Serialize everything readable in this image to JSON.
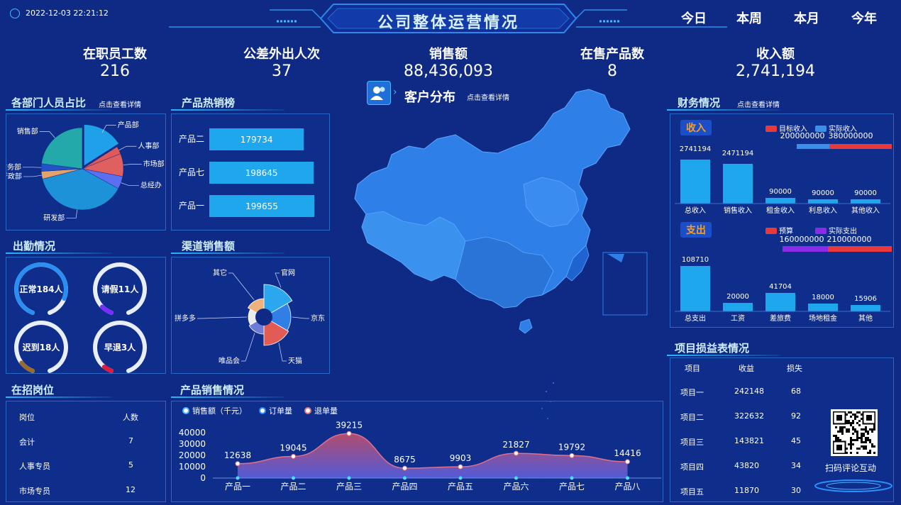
{
  "header": {
    "datetime": "2022-12-03 22:21:12",
    "title": "公司整体运营情况",
    "periods": [
      "今日",
      "本周",
      "本月",
      "今年"
    ]
  },
  "kpis": [
    {
      "label": "在职员工数",
      "value": "216"
    },
    {
      "label": "公差外出人次",
      "value": "37"
    },
    {
      "label": "销售额",
      "value": "88,436,093"
    },
    {
      "label": "在售产品数",
      "value": "8"
    },
    {
      "label": "收入额",
      "value": "2,741,194"
    }
  ],
  "dept": {
    "title": "各部门人员占比",
    "link": "点击查看详情",
    "slices": [
      {
        "name": "产品部",
        "value": 16,
        "color": "#1fa0e8"
      },
      {
        "name": "人事部",
        "value": 3,
        "color": "#e05a5a"
      },
      {
        "name": "市场部",
        "value": 9,
        "color": "#e06060"
      },
      {
        "name": "总经办",
        "value": 5,
        "color": "#5b6ff0"
      },
      {
        "name": "研发部",
        "value": 38,
        "color": "#1d92d8"
      },
      {
        "name": "行政部",
        "value": 3,
        "color": "#e4a36b"
      },
      {
        "name": "财务部",
        "value": 3,
        "color": "#2453c8"
      },
      {
        "name": "销售部",
        "value": 23,
        "color": "#23a9a9"
      }
    ]
  },
  "hot": {
    "title": "产品热销榜",
    "items": [
      {
        "name": "产品二",
        "value": 179734
      },
      {
        "name": "产品七",
        "value": 198645
      },
      {
        "name": "产品一",
        "value": 199655
      }
    ]
  },
  "map": {
    "title": "客户分布",
    "link": "点击查看详情"
  },
  "finance": {
    "title": "财务情况",
    "link": "点击查看详情",
    "income": {
      "label": "收入",
      "legend": [
        "目标收入",
        "实际收入"
      ],
      "target_total": "200000000",
      "actual_total": "380000000",
      "categories": [
        "总收入",
        "销售收入",
        "租金收入",
        "利息收入",
        "其他收入"
      ],
      "values": [
        2741194,
        2471194,
        90000,
        90000,
        90000
      ]
    },
    "expense": {
      "label": "支出",
      "legend": [
        "预算",
        "实际支出"
      ],
      "budget_total": "160000000",
      "actual_total": "210000000",
      "categories": [
        "总支出",
        "工资",
        "差旅费",
        "场地租金",
        "其他"
      ],
      "values": [
        108710,
        20000,
        41704,
        18000,
        15906
      ]
    }
  },
  "attendance": {
    "title": "出勤情况",
    "items": [
      {
        "label": "正常184人",
        "pct": 0.85,
        "color": "#2b8ff2"
      },
      {
        "label": "请假11人",
        "pct": 0.08,
        "color": "#7a2bff"
      },
      {
        "label": "迟到18人",
        "pct": 0.1,
        "color": "#9a6b2a"
      },
      {
        "label": "早退3人",
        "pct": 0.06,
        "color": "#e01a3c"
      }
    ]
  },
  "channel": {
    "title": "渠道销售额",
    "slices": [
      {
        "name": "官网",
        "value": 30,
        "color": "#2aa7ee"
      },
      {
        "name": "京东",
        "value": 22,
        "color": "#2f7fe6"
      },
      {
        "name": "天猫",
        "value": 24,
        "color": "#e25b55"
      },
      {
        "name": "唯品会",
        "value": 8,
        "color": "#6f7bd9"
      },
      {
        "name": "拼多多",
        "value": 6,
        "color": "#eaeaea"
      },
      {
        "name": "其它",
        "value": 10,
        "color": "#f0b27a"
      }
    ]
  },
  "jobs": {
    "title": "在招岗位",
    "headers": [
      "岗位",
      "人数"
    ],
    "rows": [
      [
        "会计",
        "7"
      ],
      [
        "人事专员",
        "5"
      ],
      [
        "市场专员",
        "12"
      ]
    ]
  },
  "sales": {
    "title": "产品销售情况",
    "legend": [
      "销售额（千元）",
      "订单量",
      "退单量"
    ],
    "chart_data": {
      "type": "area",
      "categories": [
        "产品一",
        "产品二",
        "产品三",
        "产品四",
        "产品五",
        "产品六",
        "产品七",
        "产品八"
      ],
      "series": [
        {
          "name": "销售额（千元）",
          "values": [
            12638,
            19045,
            39215,
            8675,
            9903,
            21827,
            19792,
            14416
          ]
        }
      ],
      "yticks": [
        "40000",
        "30000",
        "20000",
        "10000",
        "0"
      ],
      "ylim": [
        0,
        40000
      ]
    }
  },
  "project": {
    "title": "项目损益表情况",
    "headers": [
      "项目",
      "收益",
      "损失"
    ],
    "rows": [
      [
        "项目一",
        "242148",
        "68"
      ],
      [
        "项目二",
        "322632",
        "92"
      ],
      [
        "项目三",
        "143821",
        "45"
      ],
      [
        "项目四",
        "43820",
        "34"
      ],
      [
        "项目五",
        "11870",
        "30"
      ]
    ],
    "qr_label": "扫码评论互动"
  }
}
